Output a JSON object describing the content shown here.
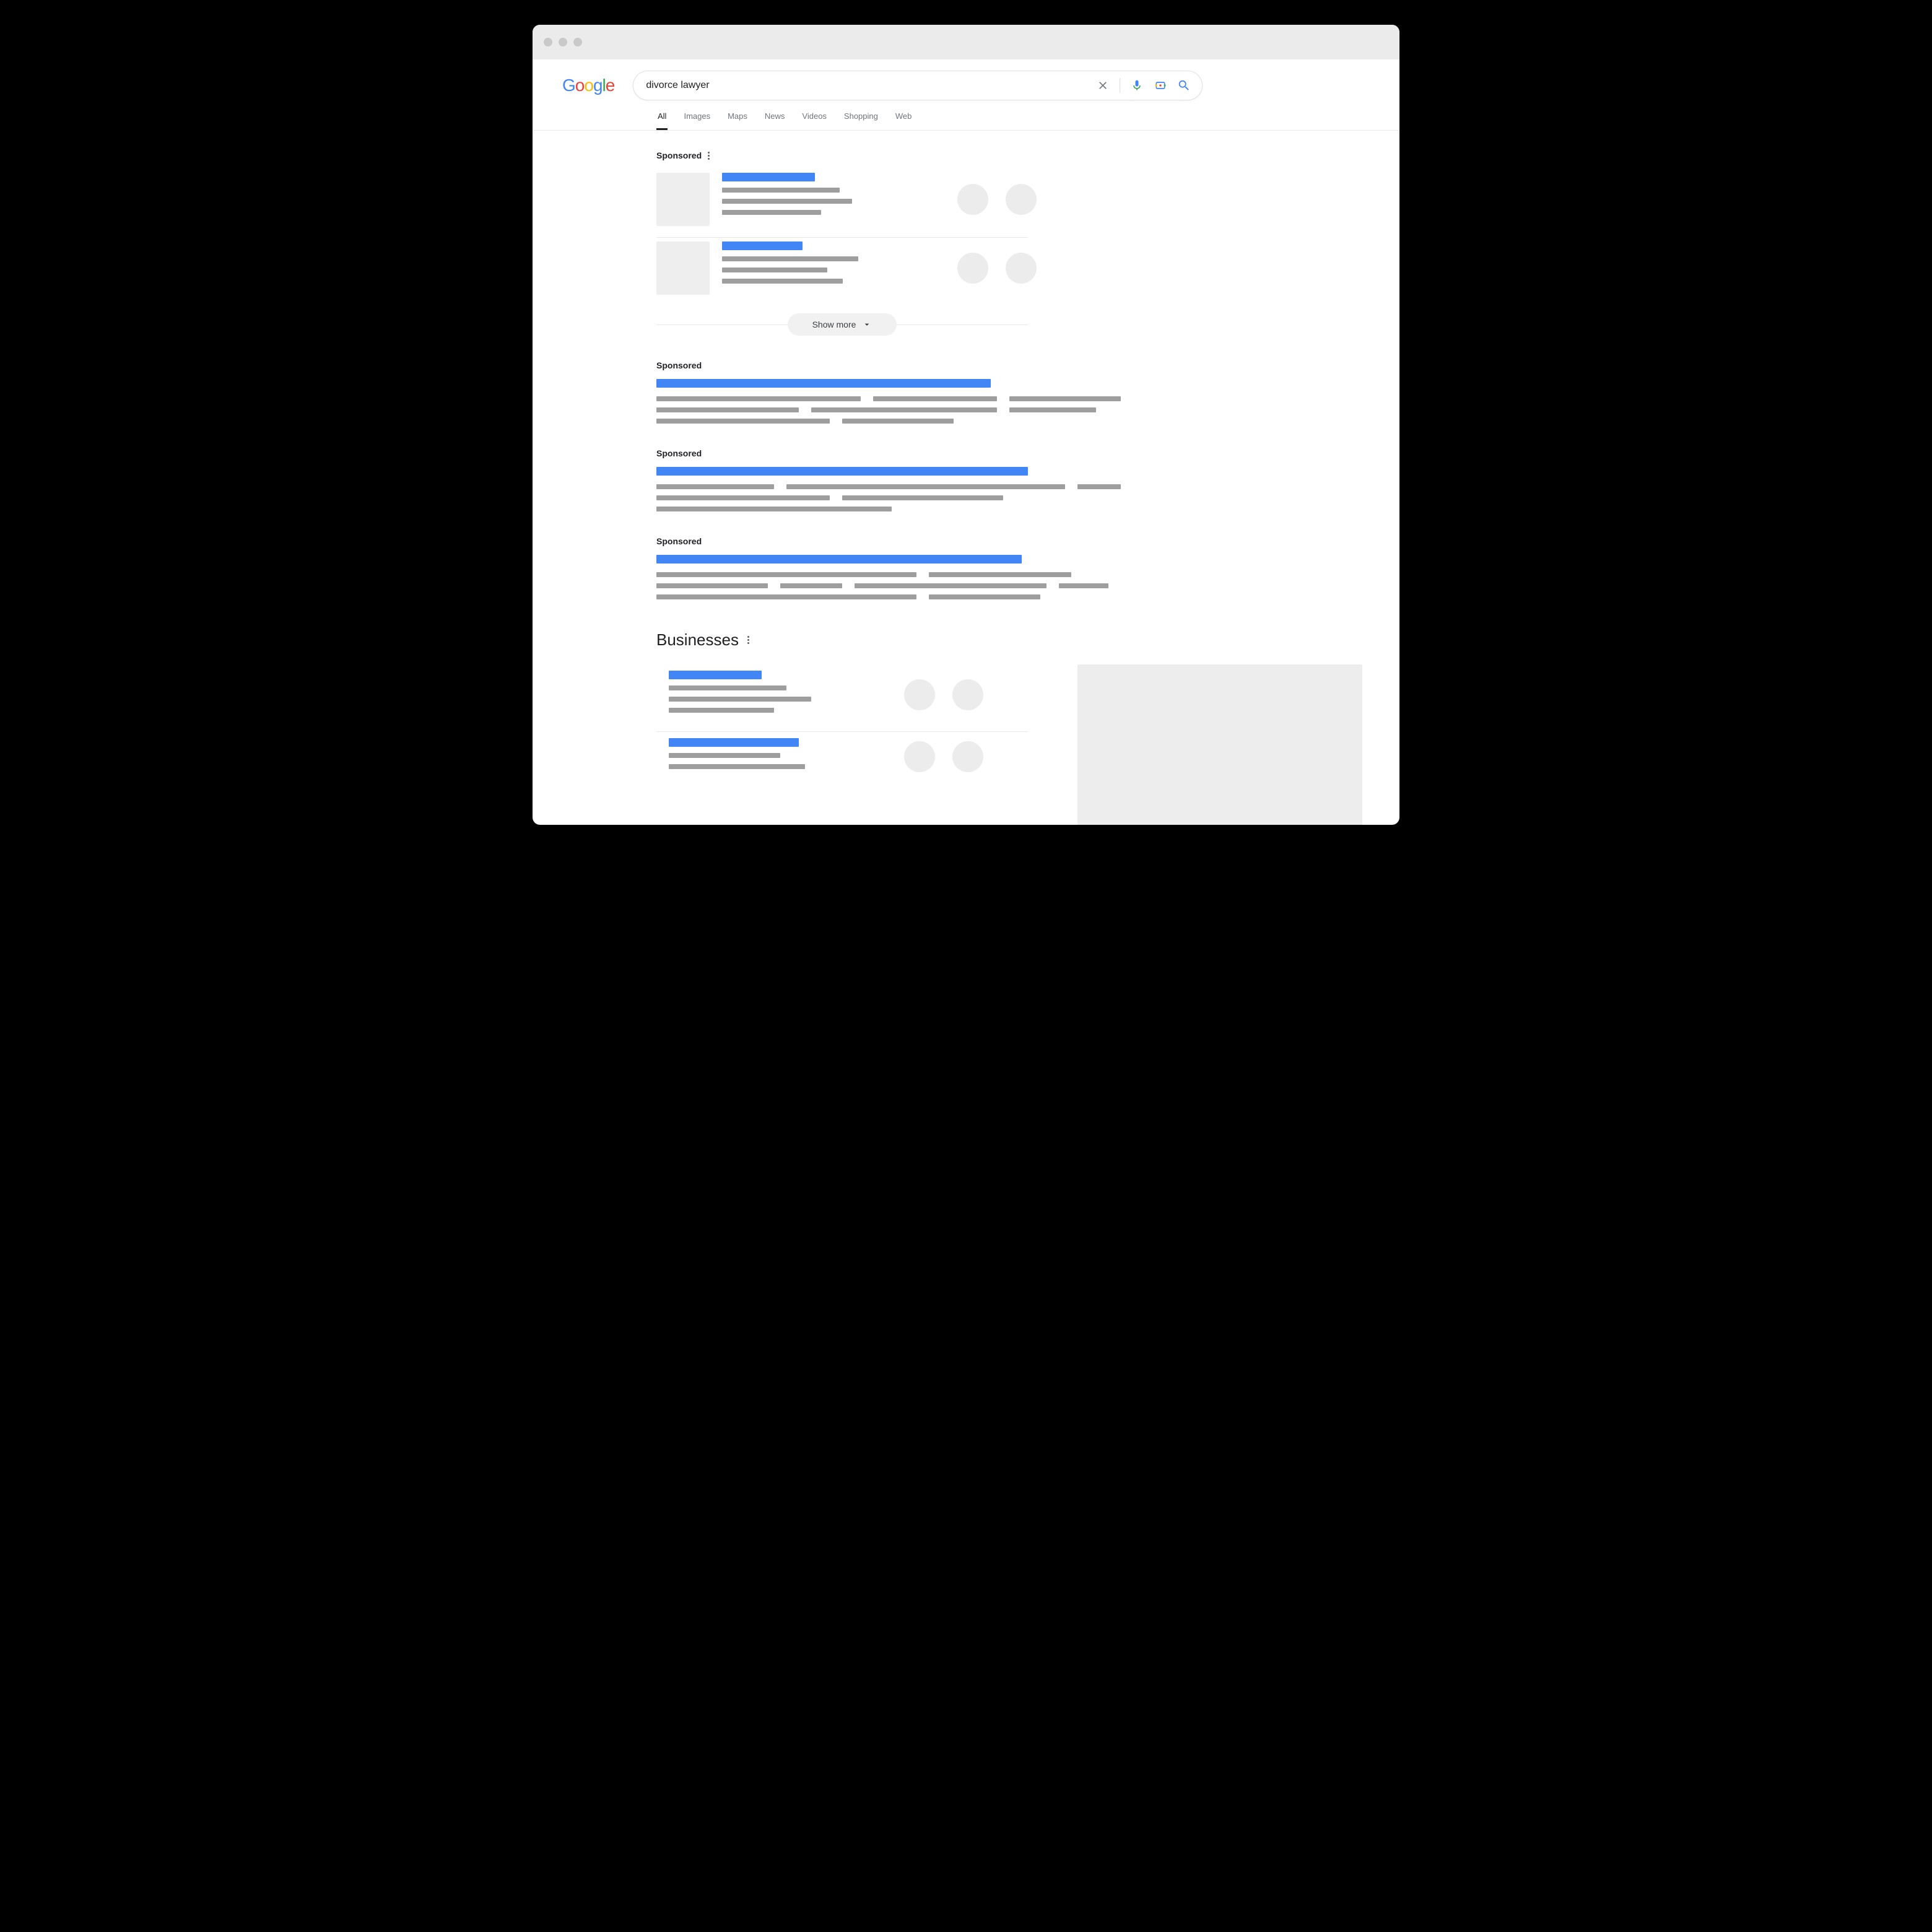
{
  "search": {
    "query": "divorce lawyer"
  },
  "tabs": [
    "All",
    "Images",
    "Maps",
    "News",
    "Videos",
    "Shopping",
    "Web"
  ],
  "active_tab": "All",
  "sponsored_label": "Sponsored",
  "show_more_label": "Show more",
  "businesses_label": "Businesses",
  "logo_letters": [
    "G",
    "o",
    "o",
    "g",
    "l",
    "e"
  ],
  "colors": {
    "accent_blue": "#4285f4",
    "grey": "#9e9e9e",
    "light_grey": "#ededed"
  }
}
